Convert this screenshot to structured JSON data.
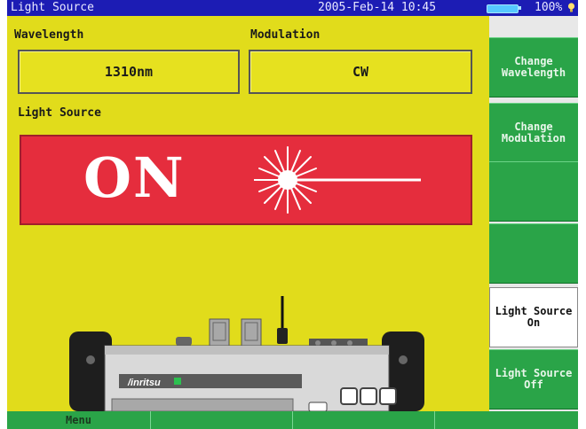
{
  "titlebar": {
    "title": "Light Source",
    "datetime": "2005-Feb-14 10:45",
    "battery": "100%"
  },
  "main": {
    "wavelength_label": "Wavelength",
    "wavelength_value": "1310nm",
    "modulation_label": "Modulation",
    "modulation_value": "CW",
    "light_source_label": "Light Source",
    "status": "ON",
    "device_brand": "/inritsu"
  },
  "sidebar": {
    "buttons": [
      {
        "line1": "Change",
        "line2": "Wavelength"
      },
      {
        "line1": "Change",
        "line2": "Modulation"
      },
      {
        "line1": "",
        "line2": ""
      },
      {
        "line1": "",
        "line2": ""
      },
      {
        "line1": "Light Source",
        "line2": "On"
      },
      {
        "line1": "Light Source",
        "line2": "Off"
      }
    ]
  },
  "bottom": {
    "menu_label": "Menu"
  },
  "colors": {
    "screen_bg": "#e1dc1b",
    "title_bg": "#1c1cb4",
    "button_green": "#2aa448",
    "status_red": "#e52d3d"
  }
}
